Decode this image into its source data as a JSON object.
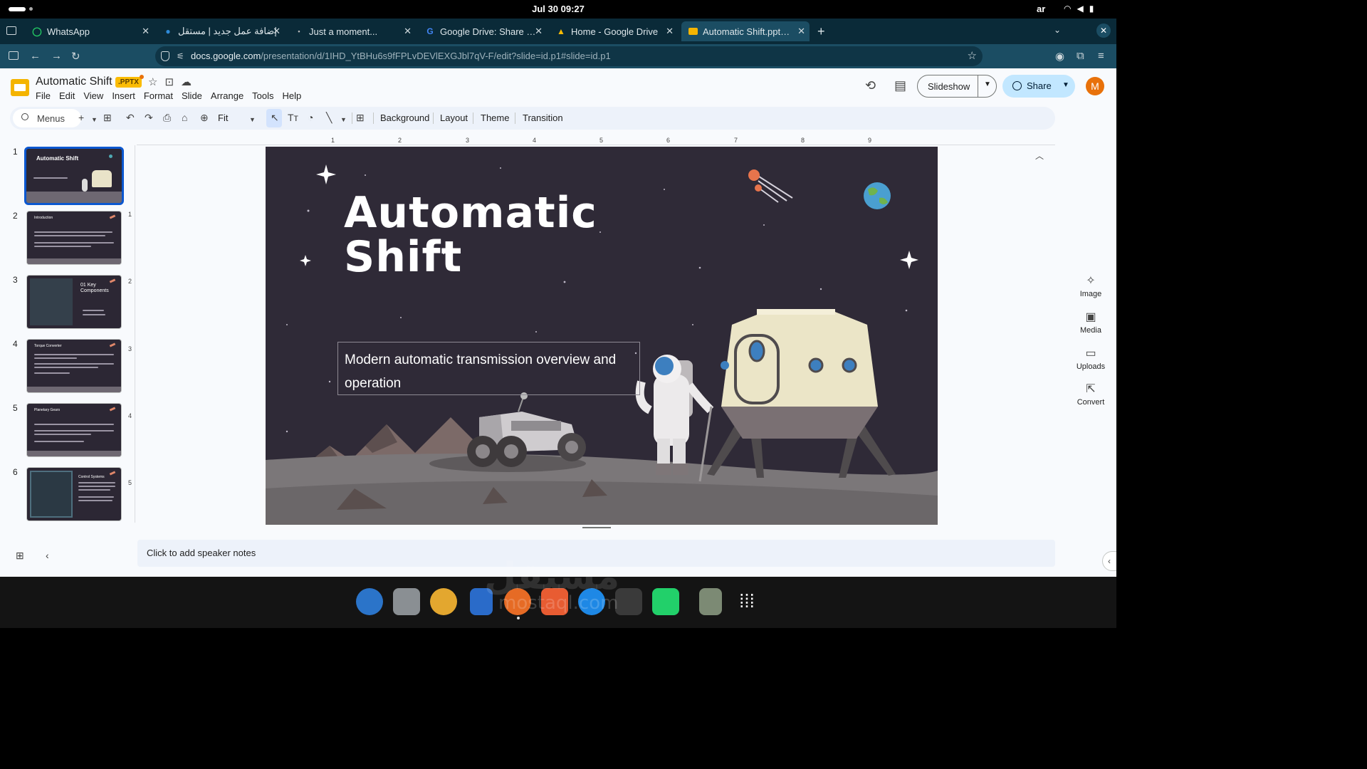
{
  "system": {
    "clock": "Jul 30  09:27",
    "lang": "ar"
  },
  "browser": {
    "tabs": [
      {
        "title": "WhatsApp",
        "icon": "whatsapp-icon",
        "color": "#25d366"
      },
      {
        "title": "إضافة عمل جديد | مستقل",
        "icon": "mostaql-icon",
        "color": "#2e8ad8"
      },
      {
        "title": "Just a moment...",
        "icon": "loading-icon",
        "color": "#bbbbbb"
      },
      {
        "title": "Google Drive: Share Files",
        "icon": "google-icon",
        "color": "#ea4335"
      },
      {
        "title": "Home - Google Drive",
        "icon": "drive-icon",
        "color": "#fbbc04"
      },
      {
        "title": "Automatic Shift.pptx - Go",
        "icon": "slides-icon",
        "color": "#f4b400"
      }
    ],
    "url_domain": "docs.google.com",
    "url_path": "/presentation/d/1IHD_YtBHu6s9fFPLvDEVlEXGJbl7qV-F/edit?slide=id.p1#slide=id.p1"
  },
  "doc": {
    "title": "Automatic Shift",
    "badge": ".PPTX",
    "menus": [
      "File",
      "Edit",
      "View",
      "Insert",
      "Format",
      "Slide",
      "Arrange",
      "Tools",
      "Help"
    ],
    "slideshow": "Slideshow",
    "share": "Share",
    "avatar": "M"
  },
  "toolbar": {
    "search": "Menus",
    "zoom": "Fit",
    "background": "Background",
    "layout": "Layout",
    "theme": "Theme",
    "transition": "Transition"
  },
  "ruler": {
    "h": [
      "1",
      "2",
      "3",
      "4",
      "5",
      "6",
      "7",
      "8",
      "9"
    ],
    "v": [
      "1",
      "2",
      "3",
      "4",
      "5"
    ]
  },
  "filmstrip": [
    {
      "num": "1",
      "title": "Automatic Shift"
    },
    {
      "num": "2",
      "title": "Introduction"
    },
    {
      "num": "3",
      "title": "01 Key Components"
    },
    {
      "num": "4",
      "title": "Torque Converter"
    },
    {
      "num": "5",
      "title": "Planetary Gears"
    },
    {
      "num": "6",
      "title": "Control Systems"
    }
  ],
  "slide": {
    "title_line1": "Automatic",
    "title_line2": "Shift",
    "subtitle": "Modern automatic transmission overview and operation"
  },
  "notes": "Click to add speaker notes",
  "side_panel": [
    "Image",
    "Media",
    "Uploads",
    "Convert"
  ],
  "watermark": {
    "arabic": "مستقل",
    "latin": "mostaql.com"
  }
}
